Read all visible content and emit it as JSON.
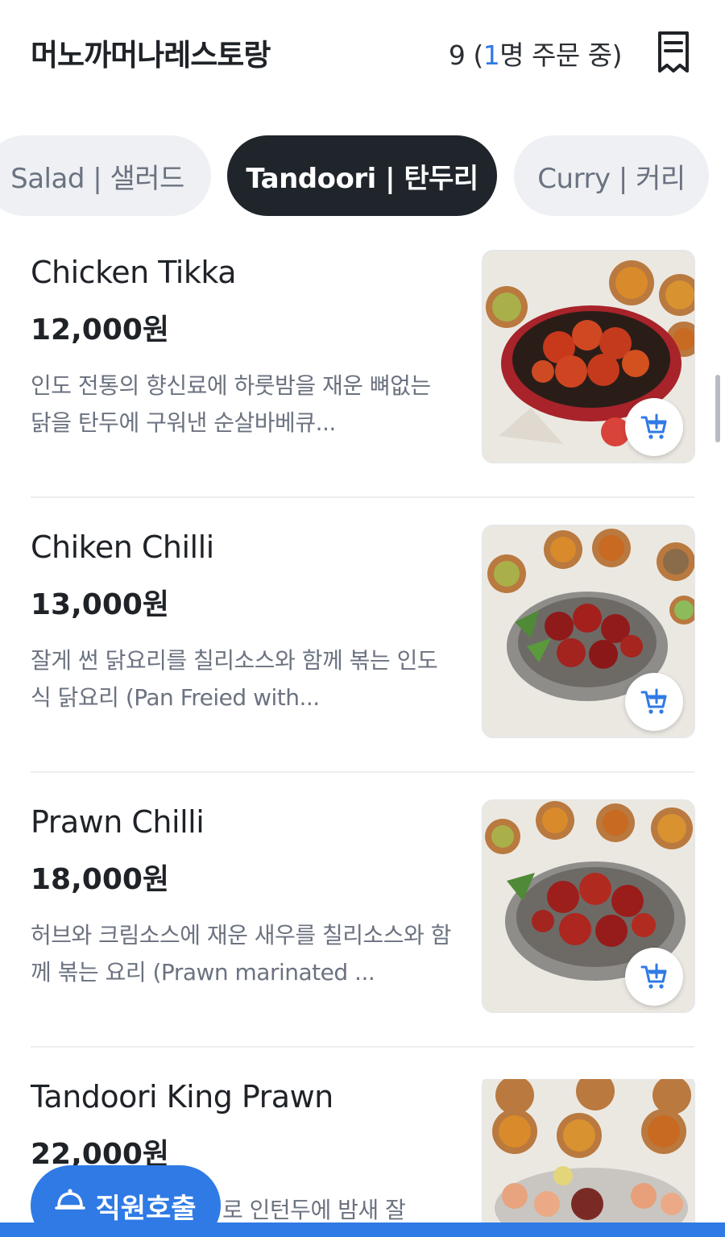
{
  "header": {
    "store_name": "머노까머나레스토랑",
    "table_number": "9",
    "order_prefix": " (",
    "order_count": "1",
    "order_suffix": "명 주문 중)",
    "receipt_icon": "receipt-icon"
  },
  "tabs": [
    {
      "label": "Salad | 샐러드",
      "active": false
    },
    {
      "label": "Tandoori | 탄두리",
      "active": true
    },
    {
      "label": "Curry | 커리",
      "active": false
    }
  ],
  "items": [
    {
      "name": "Chicken Tikka",
      "price": "12,000원",
      "description": "인도 전통의 향신료에 하룻밤을 재운 뼈없는 닭을 탄두에 구워낸 순살바베큐...",
      "cart_icon": "cart-add-icon"
    },
    {
      "name": "Chiken Chilli",
      "price": "13,000원",
      "description": "잘게 썬 닭요리를 칠리소스와 함께 볶는 인도식 닭요리 (Pan Freied with...",
      "cart_icon": "cart-add-icon"
    },
    {
      "name": "Prawn Chilli",
      "price": "18,000원",
      "description": "허브와 크림소스에 재운 새우를 칠리소스와 함께 볶는 요리 (Prawn marinated ...",
      "cart_icon": "cart-add-icon"
    },
    {
      "name": "Tandoori King Prawn",
      "price": "22,000원",
      "description": "로 인턴두에 밤새 잘",
      "cart_icon": "cart-add-icon"
    }
  ],
  "call_button": {
    "label": "직원호출",
    "icon": "bell-icon"
  },
  "colors": {
    "accent": "#2f7ae5",
    "active_tab": "#1f252b",
    "inactive_tab": "#eef0f3"
  }
}
